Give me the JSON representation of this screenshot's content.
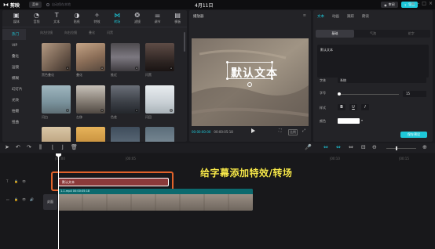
{
  "app": {
    "name": "剪映",
    "menu_label": "菜单",
    "draft_status": "自动保存本地",
    "project_title": "4月11日"
  },
  "top_right": {
    "review_label": "审阅",
    "export_label": "导出"
  },
  "tools": [
    {
      "label": "媒体",
      "icon": "media-icon"
    },
    {
      "label": "音频",
      "icon": "audio-icon"
    },
    {
      "label": "文本",
      "icon": "text-icon"
    },
    {
      "label": "贴纸",
      "icon": "sticker-icon"
    },
    {
      "label": "特效",
      "icon": "effects-icon"
    },
    {
      "label": "转场",
      "icon": "transition-icon"
    },
    {
      "label": "滤镜",
      "icon": "filter-icon"
    },
    {
      "label": "调节",
      "icon": "adjust-icon"
    },
    {
      "label": "模板",
      "icon": "template-icon"
    }
  ],
  "categories": [
    "热门",
    "VIP",
    "叠化",
    "运镜",
    "模糊",
    "幻灯片",
    "光效",
    "拍摄",
    "扭曲"
  ],
  "subtabs": [
    "向左拉镜",
    "向右拉镜",
    "叠化",
    "闪黑"
  ],
  "thumbnails": [
    {
      "caption": "黑色叠化"
    },
    {
      "caption": "叠化"
    },
    {
      "caption": "推近"
    },
    {
      "caption": "闪黑"
    },
    {
      "caption": "闪白"
    },
    {
      "caption": "左移"
    },
    {
      "caption": "色差"
    },
    {
      "caption": "闪回"
    }
  ],
  "player": {
    "title": "播放器",
    "current_time": "00:00:00:00",
    "total_time": "00:00:05:18",
    "overlay_text": "默认文本",
    "ratio_label": "比例"
  },
  "right_panel": {
    "tabs": [
      "文本",
      "动画",
      "跟踪",
      "朗读"
    ],
    "subtabs": [
      "基础",
      "气泡",
      "花字"
    ],
    "text_value": "默认文本",
    "font_label": "字体",
    "font_value": "系统",
    "size_label": "字号",
    "size_value": "15",
    "style_label": "样式",
    "style_buttons": [
      "B",
      "U",
      "I"
    ],
    "color_label": "颜色",
    "preset_button": "保存预设"
  },
  "timeline": {
    "ruler": [
      "|00:00",
      "|00:05",
      "|00:10",
      "|00:15"
    ],
    "text_clip_label": "默认文本",
    "video_clip_label": "1-1.mp4  00:00:05:18",
    "cover_label": "封面",
    "annotation": "给字幕添加特效/转场"
  },
  "colors": {
    "accent": "#1ec8d9",
    "text_clip": "#8a3a3a",
    "video_clip": "#0c6a6e",
    "annotation": "#f7e84b",
    "highlight_box": "#e0622b"
  }
}
